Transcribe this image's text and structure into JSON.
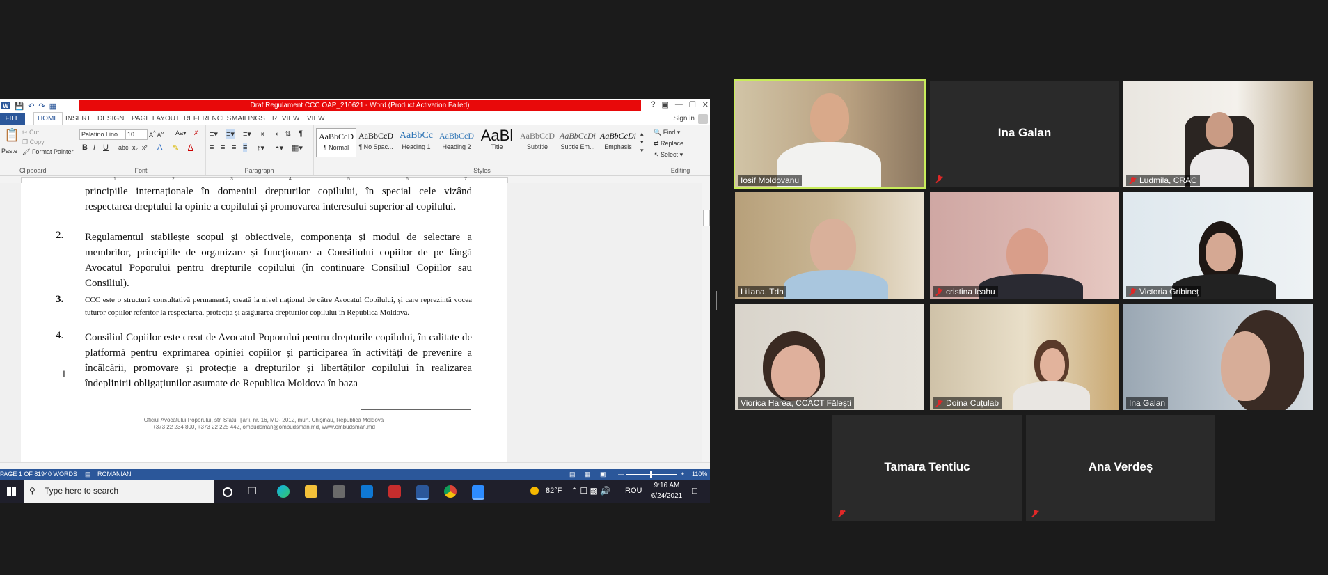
{
  "word": {
    "window_title": "Draf Regulament CCC OAP_210621 -  Word (Product Activation Failed)",
    "file_tab": "FILE",
    "tabs": [
      "HOME",
      "INSERT",
      "DESIGN",
      "PAGE LAYOUT",
      "REFERENCES",
      "MAILINGS",
      "REVIEW",
      "VIEW"
    ],
    "sign_in": "Sign in",
    "clipboard": {
      "paste": "Paste",
      "cut": "Cut",
      "copy": "Copy",
      "format_painter": "Format Painter",
      "label": "Clipboard"
    },
    "font": {
      "name": "Palatino Lino",
      "size": "10",
      "label": "Font"
    },
    "paragraph_label": "Paragraph",
    "styles_label": "Styles",
    "styles": [
      {
        "sample": "AaBbCcD",
        "name": "¶ Normal"
      },
      {
        "sample": "AaBbCcD",
        "name": "¶ No Spac..."
      },
      {
        "sample": "AaBbCc",
        "name": "Heading 1"
      },
      {
        "sample": "AaBbCcD",
        "name": "Heading 2"
      },
      {
        "sample": "AaBl",
        "name": "Title"
      },
      {
        "sample": "AaBbCcD",
        "name": "Subtitle"
      },
      {
        "sample": "AaBbCcDi",
        "name": "Subtle Em..."
      },
      {
        "sample": "AaBbCcDi",
        "name": "Emphasis"
      }
    ],
    "editing": {
      "find": "Find",
      "replace": "Replace",
      "select": "Select",
      "label": "Editing"
    },
    "ruler_marks": [
      "1",
      "2",
      "3",
      "4",
      "5",
      "6",
      "7"
    ],
    "document": {
      "intro": "principiile internaționale în domeniul drepturilor copilului, în special cele vizând respectarea dreptului la opinie a copilului și promovarea interesului superior al copilului.",
      "items": [
        {
          "num": "2.",
          "text": "Regulamentul stabilește scopul și obiectivele, componența și modul de selectare a membrilor, principiile de organizare și funcționare a Consiliului copiilor de pe lângă Avocatul Poporului pentru drepturile copilului (în continuare Consiliul Copiilor sau Consiliul)."
        },
        {
          "num": "3.",
          "text": "CCC este o structură consultativă permanentă, creată la nivel național de către Avocatul Copilului, și care reprezintă vocea tuturor copiilor referitor la respectarea, protecția și asigurarea drepturilor copilului în Republica Moldova."
        },
        {
          "num": "4.",
          "text": "Consiliul Copiilor este creat de Avocatul Poporului pentru drepturile copilului, în calitate de platformă pentru exprimarea opiniei copiilor și participarea în activități de prevenire a încălcării, promovare și protecție a drepturilor și libertăților copilului în realizarea îndeplinirii obligațiunilor asumate de Republica Moldova în baza"
        }
      ],
      "footer_line1": "Oficiul Avocatului Poporului, str. Sfatul Țării, nr. 16, MD- 2012, mun. Chișinău, Republica Moldova",
      "footer_line2": "+373 22 234 800,   +373 22 225 442, ombudsman@ombudsman.md,   www.ombudsman.md"
    },
    "status": {
      "page": "PAGE 1 OF 8",
      "words": "1940 WORDS",
      "language": "ROMANIAN",
      "zoom": "110%"
    }
  },
  "taskbar": {
    "search_placeholder": "Type here to search",
    "weather": "82°F",
    "lang": "ROU",
    "time": "9:16 AM",
    "date": "6/24/2021"
  },
  "participants": [
    {
      "name": "Iosif Moldovanu",
      "video": true,
      "muted": false,
      "active": true
    },
    {
      "name": "Ina Galan",
      "video": false,
      "muted": true,
      "active": false
    },
    {
      "name": "Ludmila, CRAC",
      "video": true,
      "muted": true,
      "active": false
    },
    {
      "name": "Liliana, Tdh",
      "video": true,
      "muted": false,
      "active": false
    },
    {
      "name": "cristina leahu",
      "video": true,
      "muted": true,
      "active": false
    },
    {
      "name": "Victoria Gribineț",
      "video": true,
      "muted": true,
      "active": false
    },
    {
      "name": "Viorica Harea, CCACT Fălești",
      "video": true,
      "muted": false,
      "active": false
    },
    {
      "name": "Doina Cuțulab",
      "video": true,
      "muted": true,
      "active": false
    },
    {
      "name": "Ina Galan",
      "video": true,
      "muted": false,
      "active": false
    },
    {
      "name": "Tamara Tentiuc",
      "video": false,
      "muted": true,
      "active": false
    },
    {
      "name": "Ana Verdeș",
      "video": false,
      "muted": true,
      "active": false
    }
  ]
}
